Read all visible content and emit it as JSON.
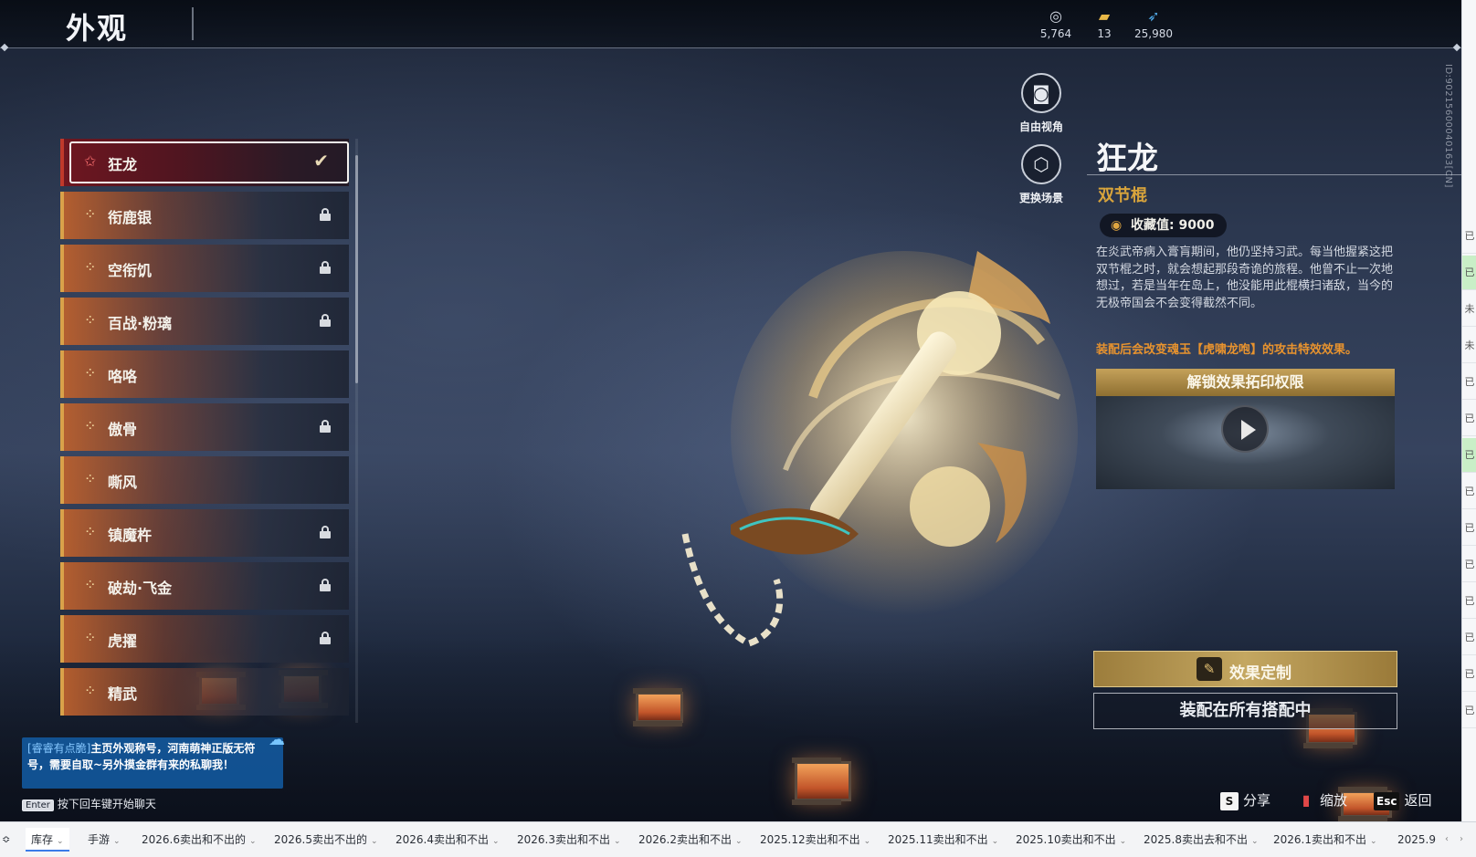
{
  "header": {
    "title": "外观",
    "currencies": [
      {
        "icon": "coin-pile-icon",
        "value": "5,764"
      },
      {
        "icon": "ticket-icon",
        "value": "13"
      },
      {
        "icon": "feather-icon",
        "value": "25,980"
      }
    ]
  },
  "side_id": "ID:9021560004016​3[CN]",
  "items": [
    {
      "label": "狂龙",
      "selected": true,
      "locked": false
    },
    {
      "label": "衔鹿银",
      "selected": false,
      "locked": true
    },
    {
      "label": "空衔饥",
      "selected": false,
      "locked": true
    },
    {
      "label": "百战·粉璃",
      "selected": false,
      "locked": true
    },
    {
      "label": "咯咯",
      "selected": false,
      "locked": false
    },
    {
      "label": "傲骨",
      "selected": false,
      "locked": true
    },
    {
      "label": "嘶风",
      "selected": false,
      "locked": false
    },
    {
      "label": "镇魔杵",
      "selected": false,
      "locked": true
    },
    {
      "label": "破劫·飞金",
      "selected": false,
      "locked": true
    },
    {
      "label": "虎擢",
      "selected": false,
      "locked": true
    },
    {
      "label": "精武",
      "selected": false,
      "locked": false
    }
  ],
  "tools": {
    "free_view": "自由视角",
    "change_scene": "更换场景"
  },
  "detail": {
    "name": "狂龙",
    "type": "双节棍",
    "collection_label": "收藏值: 9000",
    "description": "在炎武帝病入膏肓期间，他仍坚持习武。每当他握紧这把双节棍之时，就会想起那段奇诡的旅程。他曾不止一次地想过，若是当年在岛上，他没能用此棍横扫诸敌，当今的无极帝国会不会变得截然不同。",
    "effect_note": "装配后会改变魂玉【虎啸龙咆】的攻击特效效果。",
    "unlock_title": "解锁效果拓印权限",
    "customize_label": "效果定制",
    "equip_label": "装配在所有搭配中"
  },
  "chat": {
    "tag": "[睿睿有点脆]",
    "message": "主页外观称号，河南萌神正版无符号，需要自取~另外摸金群有来的私聊我！",
    "hint": "按下回车键开始聊天",
    "enter_key": "Enter"
  },
  "hotkeys": [
    {
      "key": "S",
      "label": "分享"
    },
    {
      "key": "",
      "label": "缩放"
    },
    {
      "key": "Esc",
      "label": "返回"
    }
  ],
  "right_strip": [
    "已",
    "已",
    "未",
    "未",
    "已",
    "已",
    "已",
    "已",
    "已",
    "已",
    "已",
    "已",
    "已",
    "已"
  ],
  "sheet_tabs": [
    {
      "label": "库存",
      "active": true
    },
    {
      "label": "手游",
      "active": false
    },
    {
      "label": "2026.6卖出和不出的",
      "active": false
    },
    {
      "label": "2026.5卖出不出的",
      "active": false
    },
    {
      "label": "2026.4卖出和不出",
      "active": false
    },
    {
      "label": "2026.3卖出和不出",
      "active": false
    },
    {
      "label": "2026.2卖出和不出",
      "active": false
    },
    {
      "label": "2025.12卖出和不出",
      "active": false
    },
    {
      "label": "2025.11卖出和不出",
      "active": false
    },
    {
      "label": "2025.10卖出和不出",
      "active": false
    },
    {
      "label": "2025.8卖出去和不出",
      "active": false
    },
    {
      "label": "2026.1卖出和不出",
      "active": false
    },
    {
      "label": "2025.9",
      "active": false
    }
  ],
  "colors": {
    "accent_gold": "#d8a43c",
    "selected_red": "#c0392b",
    "note_orange": "#e8932e"
  }
}
